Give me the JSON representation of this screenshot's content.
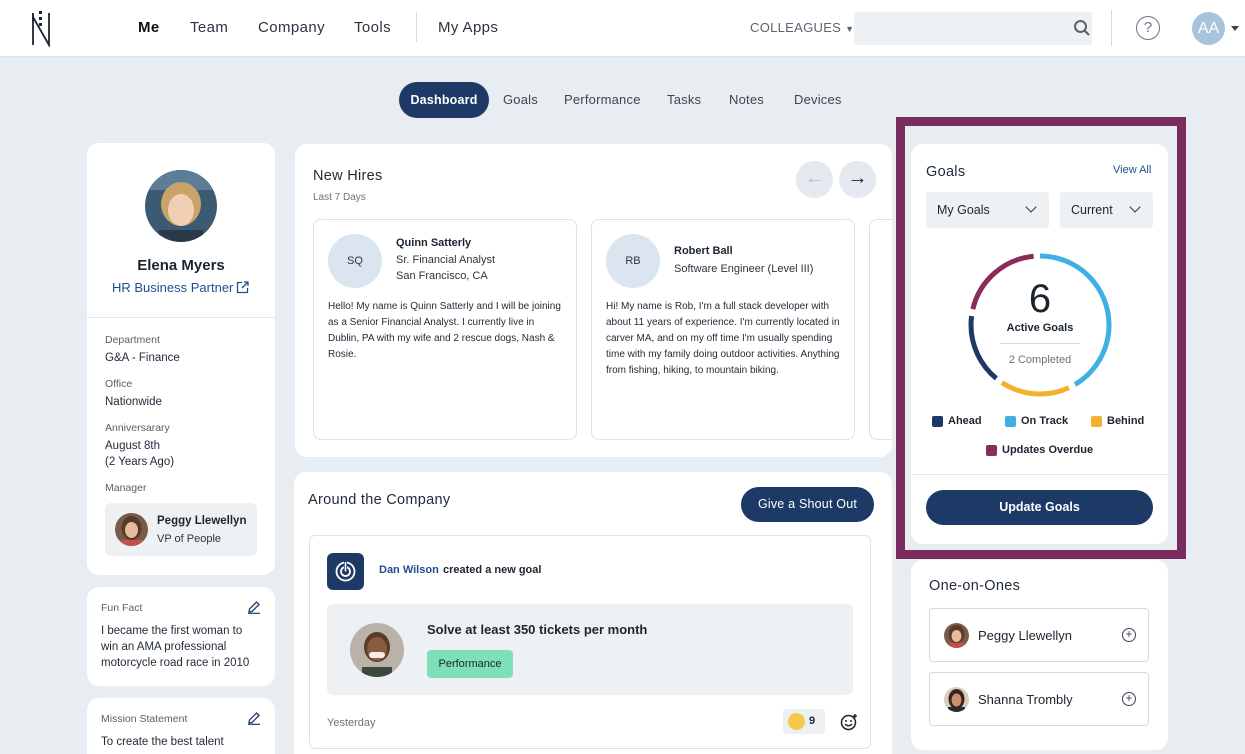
{
  "nav": {
    "links": [
      "Me",
      "Team",
      "Company",
      "Tools",
      "My Apps"
    ],
    "colleagues": "COLLEAGUES",
    "search_placeholder": "",
    "help": "?",
    "avatar_initials": "AA"
  },
  "tabs": [
    "Dashboard",
    "Goals",
    "Performance",
    "Tasks",
    "Notes",
    "Devices"
  ],
  "profile": {
    "name": "Elena Myers",
    "role": "HR Business Partner",
    "fields": [
      {
        "label": "Department",
        "value": "G&A - Finance"
      },
      {
        "label": "Office",
        "value": "Nationwide"
      },
      {
        "label": "Anniversarary",
        "value": "August 8th",
        "value2": "(2 Years Ago)"
      }
    ],
    "manager_label": "Manager",
    "manager_name": "Peggy Llewellyn",
    "manager_title": "VP of People"
  },
  "fun_fact": {
    "label": "Fun Fact",
    "text": "I became the first woman to win an AMA professional motorcycle road race in 2010"
  },
  "mission": {
    "label": "Mission Statement",
    "text": "To create the best talent"
  },
  "new_hires": {
    "title": "New Hires",
    "subtitle": "Last 7 Days",
    "items": [
      {
        "initials": "SQ",
        "name": "Quinn Satterly",
        "title": "Sr. Financial Analyst",
        "location": "San Francisco, CA",
        "bio": "Hello! My name is Quinn Satterly and I will be joining as a Senior Financial Analyst. I currently live in Dublin, PA with my wife and 2 rescue dogs, Nash & Rosie."
      },
      {
        "initials": "RB",
        "name": "Robert Ball",
        "title": "Software Engineer (Level III)",
        "location": "",
        "bio": "Hi! My name is Rob, I'm a full stack developer with about 11 years of experience. I'm currently located in carver MA, and on my off time I'm usually spending time with my family doing outdoor activities. Anything from fishing, hiking, to mountain biking."
      }
    ]
  },
  "around": {
    "title": "Around the Company",
    "shout_button": "Give a Shout Out",
    "post": {
      "actor": "Dan Wilson",
      "action": "created a new goal",
      "goal_title": "Solve at least 350 tickets per month",
      "tag": "Performance",
      "time": "Yesterday",
      "reaction_count": "9"
    }
  },
  "goals": {
    "title": "Goals",
    "view_all": "View All",
    "filter1": "My Goals",
    "filter2": "Current",
    "active_count": "6",
    "active_label": "Active Goals",
    "completed": "2 Completed",
    "legend": [
      {
        "label": "Ahead",
        "color": "#1d3a66"
      },
      {
        "label": "On Track",
        "color": "#3fb0e3"
      },
      {
        "label": "Behind",
        "color": "#f2b12e"
      },
      {
        "label": "Updates Overdue",
        "color": "#8a2c5a"
      }
    ],
    "update_button": "Update Goals",
    "highlight_color": "#7a2c5e"
  },
  "one_on_ones": {
    "title": "One-on-Ones",
    "items": [
      "Peggy Llewellyn",
      "Shanna Trombly"
    ]
  }
}
